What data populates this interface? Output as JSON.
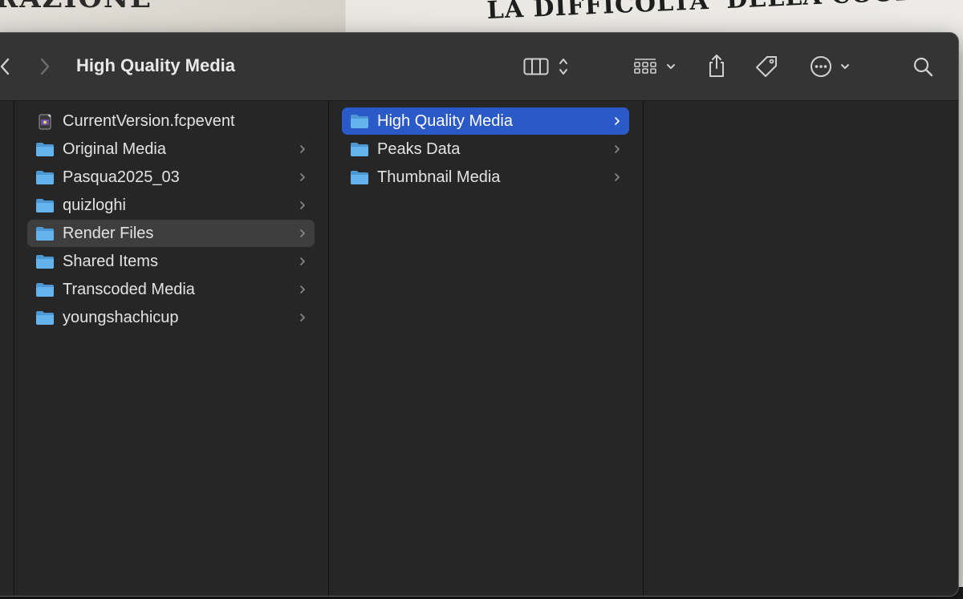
{
  "window": {
    "title": "High Quality Media"
  },
  "background": {
    "left_text": "RAZIONE",
    "right_text": "LA DIFFICOLTA' DELLA COOPERAZ"
  },
  "toolbar": {
    "icons": [
      "back-icon",
      "forward-icon",
      "column-view-icon",
      "sort-arrows-icon",
      "group-grid-icon",
      "chevron-down-icon",
      "share-icon",
      "tag-icon",
      "more-icon",
      "chevron-down-icon",
      "search-icon"
    ]
  },
  "columns": [
    {
      "items": [
        {
          "label": "CurrentVersion.fcpevent",
          "kind": "file",
          "has_children": false
        },
        {
          "label": "Original Media",
          "kind": "folder",
          "has_children": true
        },
        {
          "label": "Pasqua2025_03",
          "kind": "folder",
          "has_children": true
        },
        {
          "label": "quizloghi",
          "kind": "folder",
          "has_children": true
        },
        {
          "label": "Render Files",
          "kind": "folder",
          "has_children": true,
          "state": "hover"
        },
        {
          "label": "Shared Items",
          "kind": "folder",
          "has_children": true
        },
        {
          "label": "Transcoded Media",
          "kind": "folder",
          "has_children": true
        },
        {
          "label": "youngshachicup",
          "kind": "folder",
          "has_children": true
        }
      ]
    },
    {
      "items": [
        {
          "label": "High Quality Media",
          "kind": "folder",
          "has_children": true,
          "state": "selected"
        },
        {
          "label": "Peaks Data",
          "kind": "folder",
          "has_children": true
        },
        {
          "label": "Thumbnail Media",
          "kind": "folder",
          "has_children": true
        }
      ]
    }
  ],
  "colors": {
    "selection": "#2a59c8",
    "folder": "#5aa9e6",
    "window_bg": "#262626",
    "toolbar_bg": "#343434"
  }
}
